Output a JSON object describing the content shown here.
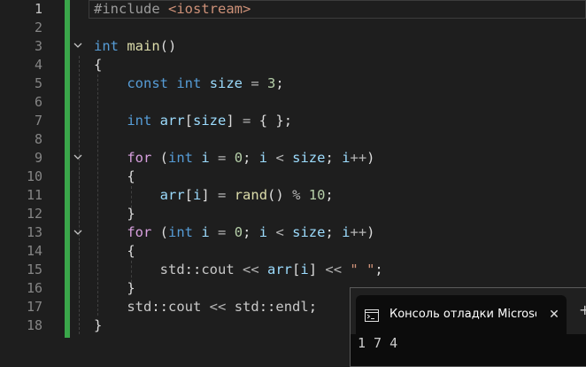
{
  "editor": {
    "active_line": 1,
    "line_numbers": [
      "1",
      "2",
      "3",
      "4",
      "5",
      "6",
      "7",
      "8",
      "9",
      "10",
      "11",
      "12",
      "13",
      "14",
      "15",
      "16",
      "17",
      "18"
    ],
    "code": {
      "l1_directive": "#include",
      "l1_header": "<iostream>",
      "l3_type": "int",
      "l3_func": "main",
      "l3_parens": "()",
      "l4_brace": "{",
      "l5_const": "const",
      "l5_type": "int",
      "l5_var": "size",
      "l5_eq": "=",
      "l5_num": "3",
      "l5_semi": ";",
      "l7_type": "int",
      "l7_var": "arr",
      "l7_lb": "[",
      "l7_size": "size",
      "l7_rb": "]",
      "l7_eq": "=",
      "l7_init": "{ };",
      "l9_for": "for",
      "l9_lp": "(",
      "l9_type": "int",
      "l9_i": "i",
      "l9_eq": "=",
      "l9_zero": "0",
      "l9_semi1": ";",
      "l9_i2": "i",
      "l9_lt": "<",
      "l9_size": "size",
      "l9_semi2": ";",
      "l9_i3": "i",
      "l9_inc": "++",
      "l9_rp": ")",
      "l10_brace": "{",
      "l11_arr": "arr",
      "l11_lb": "[",
      "l11_i": "i",
      "l11_rb": "]",
      "l11_eq": "=",
      "l11_rand": "rand",
      "l11_call": "()",
      "l11_mod": "%",
      "l11_ten": "10",
      "l11_semi": ";",
      "l12_brace": "}",
      "l13_for": "for",
      "l13_lp": "(",
      "l13_type": "int",
      "l13_i": "i",
      "l13_eq": "=",
      "l13_zero": "0",
      "l13_semi1": ";",
      "l13_i2": "i",
      "l13_lt": "<",
      "l13_size": "size",
      "l13_semi2": ";",
      "l13_i3": "i",
      "l13_inc": "++",
      "l13_rp": ")",
      "l14_brace": "{",
      "l15_std": "std",
      "l15_scope": "::",
      "l15_cout": "cout",
      "l15_shl1": "<<",
      "l15_arr": "arr",
      "l15_lb": "[",
      "l15_i": "i",
      "l15_rb": "]",
      "l15_shl2": "<<",
      "l15_str": "\" \"",
      "l15_semi": ";",
      "l16_brace": "}",
      "l17_std": "std",
      "l17_scope1": "::",
      "l17_cout": "cout",
      "l17_shl": "<<",
      "l17_std2": "std",
      "l17_scope2": "::",
      "l17_endl": "endl",
      "l17_semi": ";",
      "l18_brace": "}"
    }
  },
  "console": {
    "title": "Консоль отладки Microsoft V",
    "close_glyph": "✕",
    "new_tab_glyph": "+",
    "output": "1 7 4"
  },
  "colors": {
    "keyword": "#569cd6",
    "control": "#d8a0df",
    "function": "#dcdcaa",
    "variable": "#9cdcfe",
    "number": "#b5cea8",
    "string": "#ce9178",
    "change_bar": "#3aa64a"
  },
  "icons": {
    "fold": "chevron-down-icon",
    "console": "console-window-icon",
    "close": "close-icon",
    "new_tab": "plus-icon"
  }
}
